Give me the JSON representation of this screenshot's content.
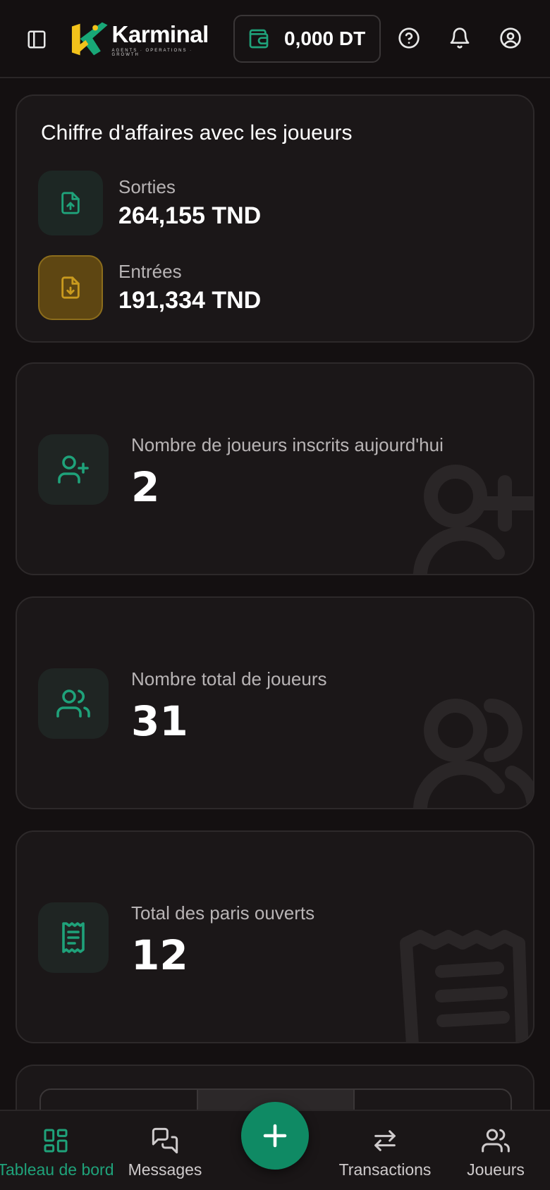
{
  "header": {
    "brand_name": "Karminal",
    "brand_tagline": "AGENTS · OPERATIONS · GROWTH",
    "wallet_balance": "0,000 DT",
    "icons": [
      "sidebar-toggle-icon",
      "wallet-icon",
      "help-icon",
      "bell-icon",
      "user-icon"
    ]
  },
  "revenue": {
    "title": "Chiffre d'affaires avec les joueurs",
    "outgoing_label": "Sorties",
    "outgoing_value": "264,155 TND",
    "incoming_label": "Entrées",
    "incoming_value": "191,334 TND"
  },
  "stats": [
    {
      "label": "Nombre de joueurs inscrits aujourd'hui",
      "value": "2",
      "icon": "user-plus-icon"
    },
    {
      "label": "Nombre total de joueurs",
      "value": "31",
      "icon": "users-icon"
    },
    {
      "label": "Total des paris ouverts",
      "value": "12",
      "icon": "receipt-icon"
    }
  ],
  "bottom_nav": {
    "items": [
      {
        "label": "Tableau de bord",
        "icon": "dashboard-icon",
        "active": true
      },
      {
        "label": "Messages",
        "icon": "messages-icon",
        "active": false
      },
      {
        "label": "Transactions",
        "icon": "transfer-icon",
        "active": false
      },
      {
        "label": "Joueurs",
        "icon": "users-icon",
        "active": false
      }
    ],
    "fab_icon": "plus-icon"
  },
  "colors": {
    "background": "#141011",
    "card": "#1b1718",
    "accent_green": "#1fa27a",
    "fab_green": "#0f8a64",
    "gold": "#c99a1e"
  }
}
